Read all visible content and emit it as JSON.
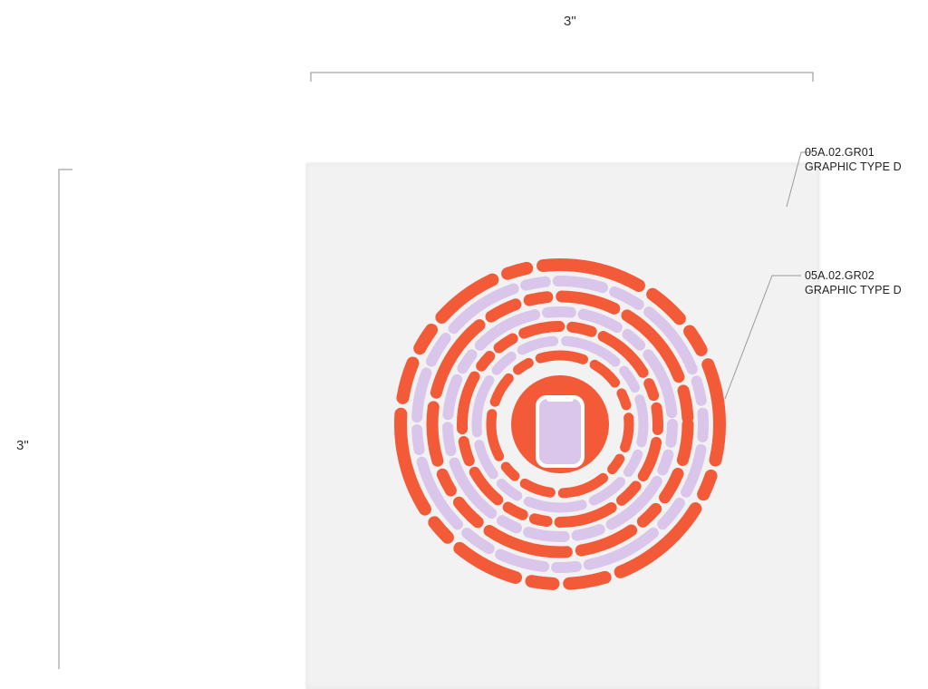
{
  "dimensions": {
    "width_label": "3\"",
    "height_label": "3\""
  },
  "callouts": [
    {
      "code": "05A.02.GR01",
      "label": "GRAPHIC TYPE D"
    },
    {
      "code": "05A.02.GR02",
      "label": "GRAPHIC TYPE D"
    }
  ],
  "graphic": {
    "central_icon": "phone-icon",
    "colors": {
      "accent": "#f25a38",
      "secondary": "#d9c6ea",
      "panel": "#f2f2f2",
      "line": "#9a9a9a"
    }
  }
}
